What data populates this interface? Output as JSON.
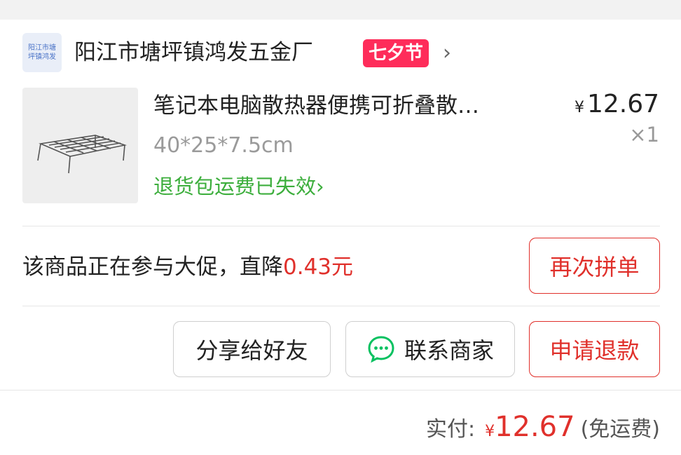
{
  "shop": {
    "logo_text": "阳江市塘坪镇鸿发",
    "name": "阳江市塘坪镇鸿发五金厂",
    "badge": "七夕节",
    "chevron": "›"
  },
  "product": {
    "title": "笔记本电脑散热器便携可折叠散…",
    "spec": "40*25*7.5cm",
    "return_status": "退货包运费已失效",
    "return_chevron": "›",
    "currency": "¥",
    "price": "12.67",
    "quantity": "×1"
  },
  "promo": {
    "text": "该商品正在参与大促，直降",
    "amount": "0.43元"
  },
  "buttons": {
    "reorder": "再次拼单",
    "share": "分享给好友",
    "contact": "联系商家",
    "refund": "申请退款"
  },
  "footer": {
    "paid_label": "实付:",
    "currency": "¥",
    "paid_amount": "12.67",
    "shipping_note": "(免运费)"
  },
  "colors": {
    "accent_red": "#e0302b",
    "badge_pink": "#fe2c5a",
    "status_green": "#3cae3c",
    "wechat_green": "#07c160"
  },
  "icons": {
    "wechat": "wechat-chat-bubble-icon",
    "product_image": "wire-cooling-rack"
  }
}
